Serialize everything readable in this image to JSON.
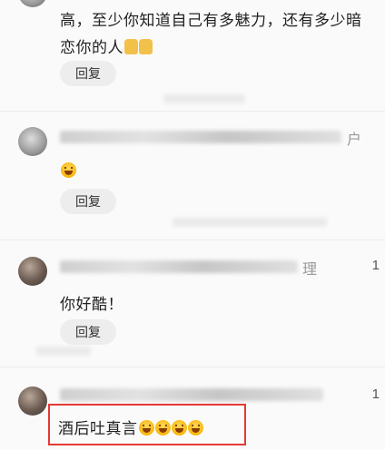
{
  "comments": [
    {
      "text_line1": "高，至少你知道自己有多魅力，还有多少暗",
      "text_line2": "恋你的人",
      "emojis": [
        "thumbs-up-icon",
        "thumbs-up-icon"
      ],
      "reply_label": "回复"
    },
    {
      "name_tail": "户",
      "emojis": [
        "grin-emoji-icon"
      ],
      "reply_label": "回复"
    },
    {
      "name_tail": "理",
      "count": "1",
      "text": "你好酷！",
      "reply_label": "回复"
    },
    {
      "count": "1",
      "text": "酒后吐真言",
      "emojis": [
        "grin-emoji-icon",
        "grin-emoji-icon",
        "grin-emoji-icon",
        "grin-emoji-icon"
      ]
    }
  ],
  "colors": {
    "highlight": "#e53935",
    "reply_bg": "#ededed",
    "background": "#fafafa"
  }
}
